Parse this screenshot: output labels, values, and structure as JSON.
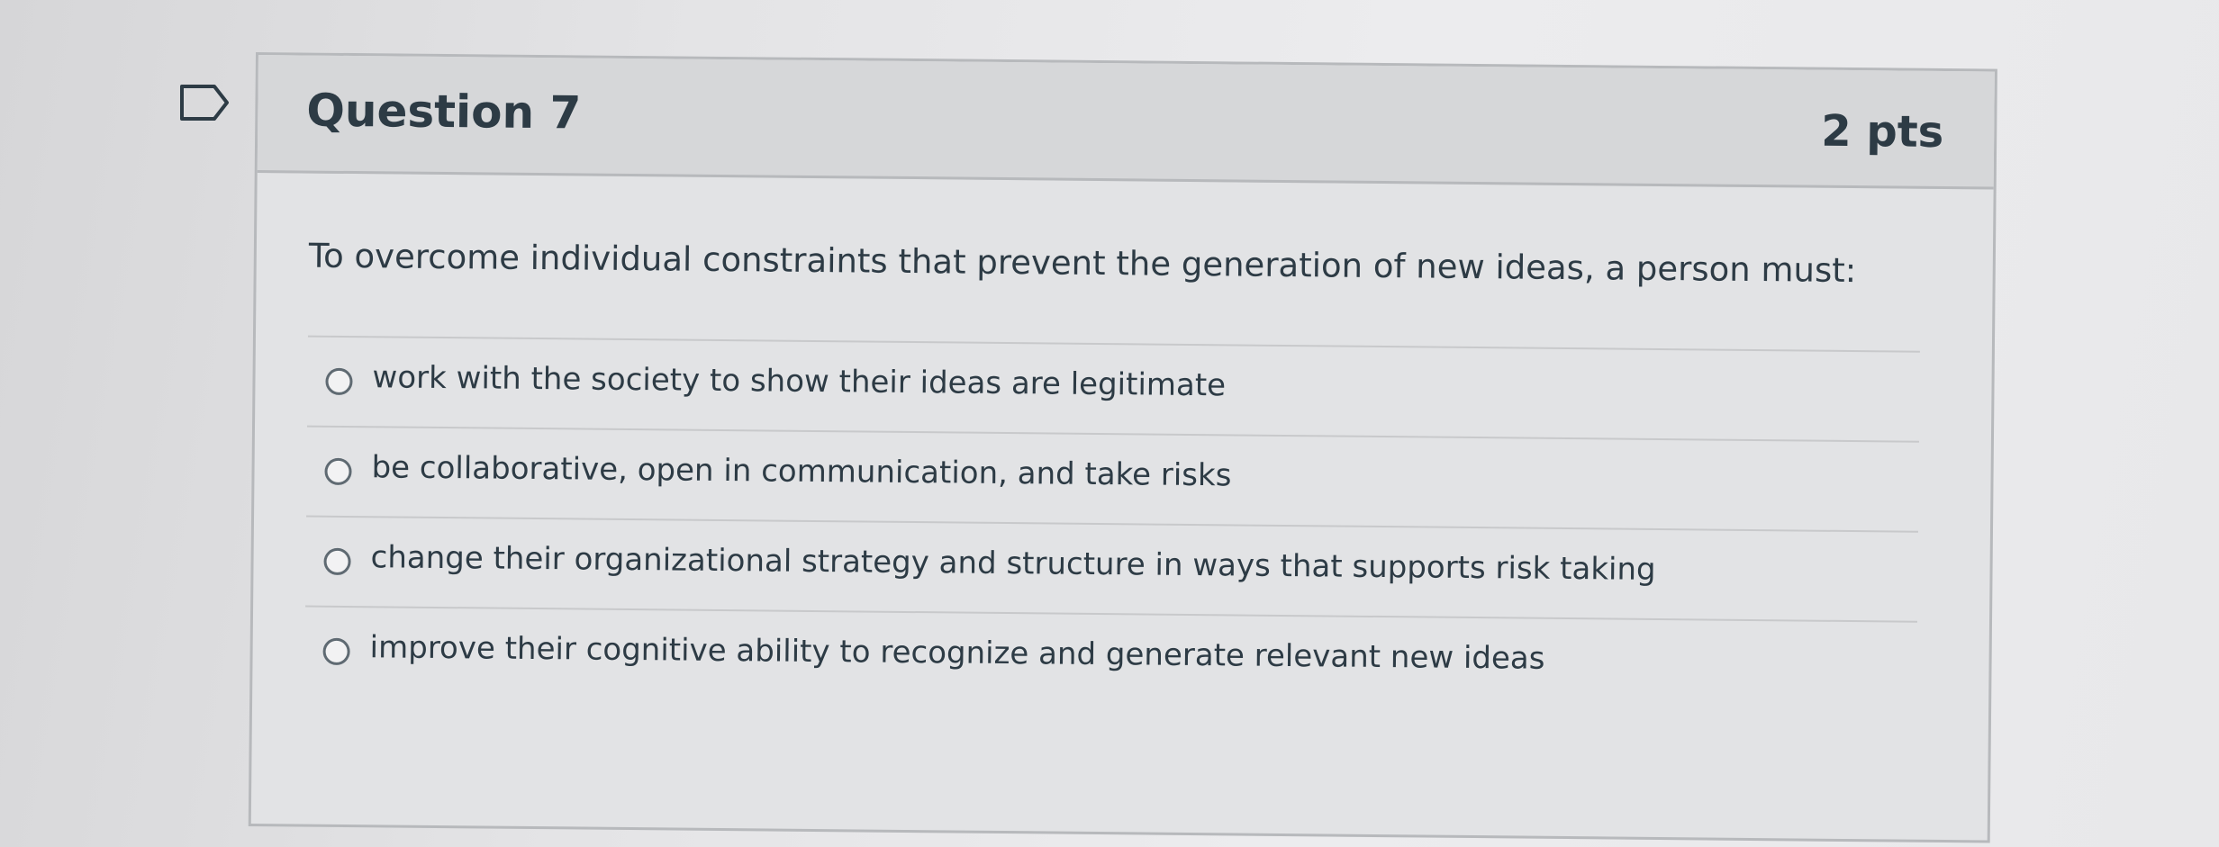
{
  "question": {
    "title": "Question 7",
    "points": "2 pts",
    "text": "To overcome individual constraints that prevent the generation of new ideas, a person must:",
    "answers": [
      "work with the society to show their ideas are legitimate",
      "be collaborative, open in communication, and take risks",
      "change their organizational strategy and structure in ways that supports risk taking",
      "improve their cognitive ability to recognize and generate relevant new ideas"
    ],
    "selected_answer": null
  },
  "icons": {
    "flag": "flag-question-icon"
  },
  "colors": {
    "text": "#2d3b45",
    "header_bg": "#d6d7d9",
    "border": "#b7b9bc"
  }
}
